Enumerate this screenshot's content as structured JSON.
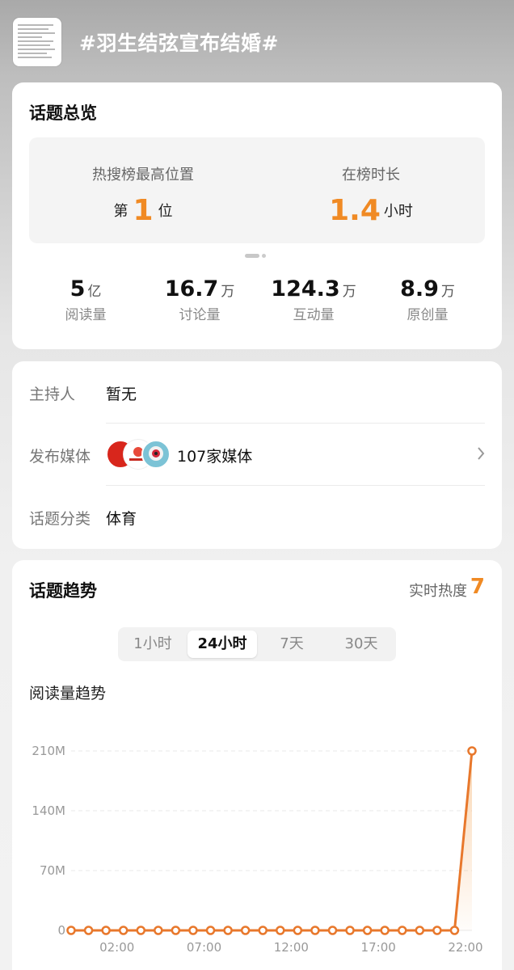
{
  "header": {
    "title": "#羽生结弦宣布结婚#",
    "thumbnail_icon": "article-thumbnail"
  },
  "overview": {
    "title": "话题总览",
    "hot_rank_label": "热搜榜最高位置",
    "hot_rank_prefix": "第",
    "hot_rank_value": "1",
    "hot_rank_suffix": "位",
    "duration_label": "在榜时长",
    "duration_value": "1.4",
    "duration_unit": "小时",
    "stats": [
      {
        "value": "5",
        "unit": "亿",
        "label": "阅读量"
      },
      {
        "value": "16.7",
        "unit": "万",
        "label": "讨论量"
      },
      {
        "value": "124.3",
        "unit": "万",
        "label": "互动量"
      },
      {
        "value": "8.9",
        "unit": "万",
        "label": "原创量"
      }
    ]
  },
  "info": {
    "host_label": "主持人",
    "host_value": "暂无",
    "media_label": "发布媒体",
    "media_value": "107家媒体",
    "category_label": "话题分类",
    "category_value": "体育"
  },
  "trend": {
    "title": "话题趋势",
    "heat_label": "实时热度",
    "heat_value": "7",
    "tabs": [
      "1小时",
      "24小时",
      "7天",
      "30天"
    ],
    "active_tab": "24小时",
    "subtitle": "阅读量趋势"
  },
  "colors": {
    "accent": "#f08a24",
    "line": "#e8782c"
  },
  "chart_data": {
    "type": "line",
    "title": "阅读量趋势",
    "x": [
      0,
      1,
      2,
      3,
      4,
      5,
      6,
      7,
      8,
      9,
      10,
      11,
      12,
      13,
      14,
      15,
      16,
      17,
      18,
      19,
      20,
      21,
      22,
      23
    ],
    "values": [
      0,
      0,
      0,
      0,
      0,
      0,
      0,
      0,
      0,
      0,
      0,
      0,
      0,
      0,
      0,
      0,
      0,
      0,
      0,
      0,
      0,
      0,
      0,
      210
    ],
    "value_unit": "M",
    "x_tick_labels": [
      "02:00",
      "07:00",
      "12:00",
      "17:00",
      "22:00"
    ],
    "y_tick_labels": [
      "0",
      "70M",
      "140M",
      "210M"
    ],
    "y_ticks": [
      0,
      70,
      140,
      210
    ],
    "ylim": [
      0,
      210
    ],
    "grid": true
  }
}
